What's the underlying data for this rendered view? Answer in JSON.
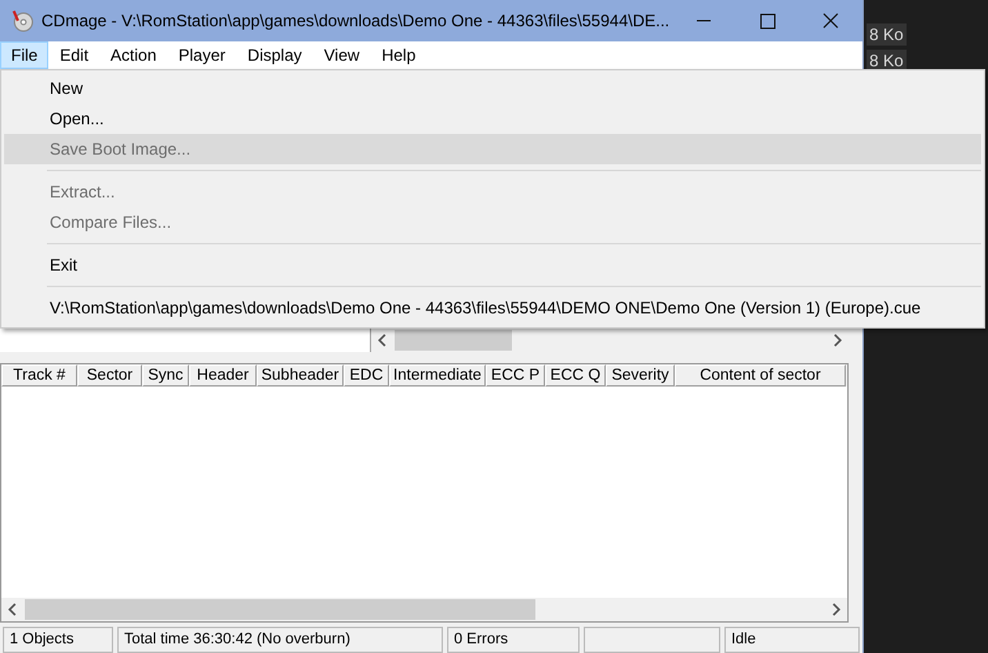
{
  "window": {
    "title": "CDmage - V:\\RomStation\\app\\games\\downloads\\Demo One - 44363\\files\\55944\\DE..."
  },
  "menubar": [
    {
      "label": "File",
      "selected": true
    },
    {
      "label": "Edit",
      "selected": false
    },
    {
      "label": "Action",
      "selected": false
    },
    {
      "label": "Player",
      "selected": false
    },
    {
      "label": "Display",
      "selected": false
    },
    {
      "label": "View",
      "selected": false
    },
    {
      "label": "Help",
      "selected": false
    }
  ],
  "file_menu": [
    {
      "kind": "item",
      "label": "New",
      "disabled": false,
      "selected": false
    },
    {
      "kind": "item",
      "label": "Open...",
      "disabled": false,
      "selected": false
    },
    {
      "kind": "item",
      "label": "Save Boot Image...",
      "disabled": true,
      "selected": true
    },
    {
      "kind": "separator"
    },
    {
      "kind": "item",
      "label": "Extract...",
      "disabled": true,
      "selected": false
    },
    {
      "kind": "item",
      "label": "Compare Files...",
      "disabled": true,
      "selected": false
    },
    {
      "kind": "separator"
    },
    {
      "kind": "item",
      "label": "Exit",
      "disabled": false,
      "selected": false
    },
    {
      "kind": "separator"
    },
    {
      "kind": "item",
      "label": "V:\\RomStation\\app\\games\\downloads\\Demo One - 44363\\files\\55944\\DEMO ONE\\Demo One (Version 1) (Europe).cue",
      "disabled": false,
      "selected": false
    }
  ],
  "sector_table": {
    "columns": [
      "Track #",
      "Sector",
      "Sync",
      "Header",
      "Subheader",
      "EDC",
      "Intermediate",
      "ECC P",
      "ECC Q",
      "Severity",
      "Content of sector"
    ]
  },
  "status_bar": [
    "1 Objects",
    "Total time 36:30:42 (No overburn)",
    "0 Errors",
    "Idle"
  ],
  "background_texts": [
    "8 Ko",
    "8 Ko"
  ]
}
